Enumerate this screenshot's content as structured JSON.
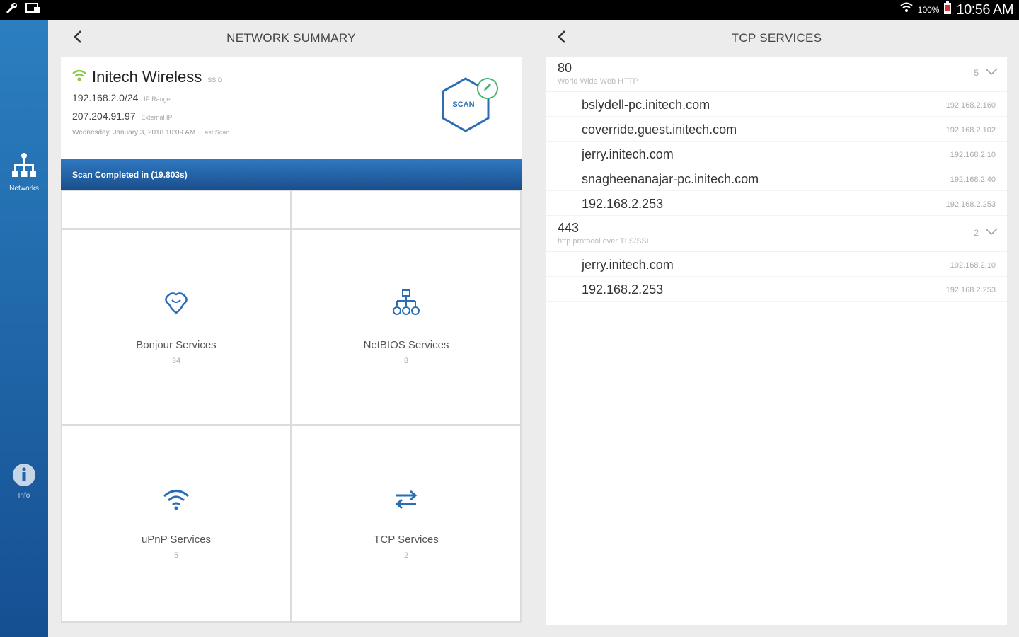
{
  "status_bar": {
    "battery": "100%",
    "time": "10:56 AM"
  },
  "rail": {
    "networks_label": "Networks",
    "info_label": "Info"
  },
  "left_panel": {
    "title": "NETWORK SUMMARY",
    "network": {
      "name": "Initech Wireless",
      "name_tag": "SSID",
      "ip_range": "192.168.2.0/24",
      "ip_range_tag": "IP Range",
      "external_ip": "207.204.91.97",
      "external_ip_tag": "External IP",
      "last_scan": "Wednesday, January 3, 2018 10:09 AM",
      "last_scan_tag": "Last Scan",
      "scan_button": "SCAN"
    },
    "scan_status": "Scan Completed in (19.803s)",
    "tiles": [
      {
        "title": "Bonjour Services",
        "count": "34"
      },
      {
        "title": "NetBIOS Services",
        "count": "8"
      },
      {
        "title": "uPnP Services",
        "count": "5"
      },
      {
        "title": "TCP Services",
        "count": "2"
      }
    ]
  },
  "right_panel": {
    "title": "TCP SERVICES",
    "groups": [
      {
        "port": "80",
        "description": "World Wide Web HTTP",
        "count": "5",
        "hosts": [
          {
            "host": "bslydell-pc.initech.com",
            "ip": "192.168.2.160"
          },
          {
            "host": "coverride.guest.initech.com",
            "ip": "192.168.2.102"
          },
          {
            "host": "jerry.initech.com",
            "ip": "192.168.2.10"
          },
          {
            "host": "snagheenanajar-pc.initech.com",
            "ip": "192.168.2.40"
          },
          {
            "host": "192.168.2.253",
            "ip": "192.168.2.253"
          }
        ]
      },
      {
        "port": "443",
        "description": "http protocol over TLS/SSL",
        "count": "2",
        "hosts": [
          {
            "host": "jerry.initech.com",
            "ip": "192.168.2.10"
          },
          {
            "host": "192.168.2.253",
            "ip": "192.168.2.253"
          }
        ]
      }
    ]
  },
  "colors": {
    "accent_blue": "#1f6bb5",
    "wifi_green": "#8dc63f"
  }
}
